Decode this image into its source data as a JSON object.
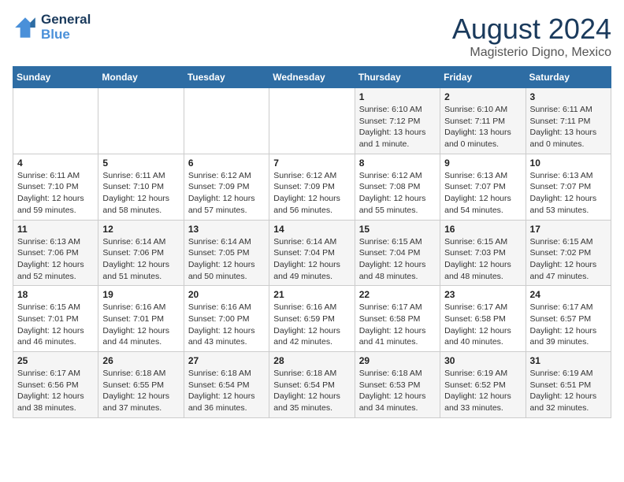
{
  "header": {
    "logo_line1": "General",
    "logo_line2": "Blue",
    "month_year": "August 2024",
    "location": "Magisterio Digno, Mexico"
  },
  "days_of_week": [
    "Sunday",
    "Monday",
    "Tuesday",
    "Wednesday",
    "Thursday",
    "Friday",
    "Saturday"
  ],
  "weeks": [
    [
      {
        "day": "",
        "info": ""
      },
      {
        "day": "",
        "info": ""
      },
      {
        "day": "",
        "info": ""
      },
      {
        "day": "",
        "info": ""
      },
      {
        "day": "1",
        "info": "Sunrise: 6:10 AM\nSunset: 7:12 PM\nDaylight: 13 hours\nand 1 minute."
      },
      {
        "day": "2",
        "info": "Sunrise: 6:10 AM\nSunset: 7:11 PM\nDaylight: 13 hours\nand 0 minutes."
      },
      {
        "day": "3",
        "info": "Sunrise: 6:11 AM\nSunset: 7:11 PM\nDaylight: 13 hours\nand 0 minutes."
      }
    ],
    [
      {
        "day": "4",
        "info": "Sunrise: 6:11 AM\nSunset: 7:10 PM\nDaylight: 12 hours\nand 59 minutes."
      },
      {
        "day": "5",
        "info": "Sunrise: 6:11 AM\nSunset: 7:10 PM\nDaylight: 12 hours\nand 58 minutes."
      },
      {
        "day": "6",
        "info": "Sunrise: 6:12 AM\nSunset: 7:09 PM\nDaylight: 12 hours\nand 57 minutes."
      },
      {
        "day": "7",
        "info": "Sunrise: 6:12 AM\nSunset: 7:09 PM\nDaylight: 12 hours\nand 56 minutes."
      },
      {
        "day": "8",
        "info": "Sunrise: 6:12 AM\nSunset: 7:08 PM\nDaylight: 12 hours\nand 55 minutes."
      },
      {
        "day": "9",
        "info": "Sunrise: 6:13 AM\nSunset: 7:07 PM\nDaylight: 12 hours\nand 54 minutes."
      },
      {
        "day": "10",
        "info": "Sunrise: 6:13 AM\nSunset: 7:07 PM\nDaylight: 12 hours\nand 53 minutes."
      }
    ],
    [
      {
        "day": "11",
        "info": "Sunrise: 6:13 AM\nSunset: 7:06 PM\nDaylight: 12 hours\nand 52 minutes."
      },
      {
        "day": "12",
        "info": "Sunrise: 6:14 AM\nSunset: 7:06 PM\nDaylight: 12 hours\nand 51 minutes."
      },
      {
        "day": "13",
        "info": "Sunrise: 6:14 AM\nSunset: 7:05 PM\nDaylight: 12 hours\nand 50 minutes."
      },
      {
        "day": "14",
        "info": "Sunrise: 6:14 AM\nSunset: 7:04 PM\nDaylight: 12 hours\nand 49 minutes."
      },
      {
        "day": "15",
        "info": "Sunrise: 6:15 AM\nSunset: 7:04 PM\nDaylight: 12 hours\nand 48 minutes."
      },
      {
        "day": "16",
        "info": "Sunrise: 6:15 AM\nSunset: 7:03 PM\nDaylight: 12 hours\nand 48 minutes."
      },
      {
        "day": "17",
        "info": "Sunrise: 6:15 AM\nSunset: 7:02 PM\nDaylight: 12 hours\nand 47 minutes."
      }
    ],
    [
      {
        "day": "18",
        "info": "Sunrise: 6:15 AM\nSunset: 7:01 PM\nDaylight: 12 hours\nand 46 minutes."
      },
      {
        "day": "19",
        "info": "Sunrise: 6:16 AM\nSunset: 7:01 PM\nDaylight: 12 hours\nand 44 minutes."
      },
      {
        "day": "20",
        "info": "Sunrise: 6:16 AM\nSunset: 7:00 PM\nDaylight: 12 hours\nand 43 minutes."
      },
      {
        "day": "21",
        "info": "Sunrise: 6:16 AM\nSunset: 6:59 PM\nDaylight: 12 hours\nand 42 minutes."
      },
      {
        "day": "22",
        "info": "Sunrise: 6:17 AM\nSunset: 6:58 PM\nDaylight: 12 hours\nand 41 minutes."
      },
      {
        "day": "23",
        "info": "Sunrise: 6:17 AM\nSunset: 6:58 PM\nDaylight: 12 hours\nand 40 minutes."
      },
      {
        "day": "24",
        "info": "Sunrise: 6:17 AM\nSunset: 6:57 PM\nDaylight: 12 hours\nand 39 minutes."
      }
    ],
    [
      {
        "day": "25",
        "info": "Sunrise: 6:17 AM\nSunset: 6:56 PM\nDaylight: 12 hours\nand 38 minutes."
      },
      {
        "day": "26",
        "info": "Sunrise: 6:18 AM\nSunset: 6:55 PM\nDaylight: 12 hours\nand 37 minutes."
      },
      {
        "day": "27",
        "info": "Sunrise: 6:18 AM\nSunset: 6:54 PM\nDaylight: 12 hours\nand 36 minutes."
      },
      {
        "day": "28",
        "info": "Sunrise: 6:18 AM\nSunset: 6:54 PM\nDaylight: 12 hours\nand 35 minutes."
      },
      {
        "day": "29",
        "info": "Sunrise: 6:18 AM\nSunset: 6:53 PM\nDaylight: 12 hours\nand 34 minutes."
      },
      {
        "day": "30",
        "info": "Sunrise: 6:19 AM\nSunset: 6:52 PM\nDaylight: 12 hours\nand 33 minutes."
      },
      {
        "day": "31",
        "info": "Sunrise: 6:19 AM\nSunset: 6:51 PM\nDaylight: 12 hours\nand 32 minutes."
      }
    ]
  ]
}
